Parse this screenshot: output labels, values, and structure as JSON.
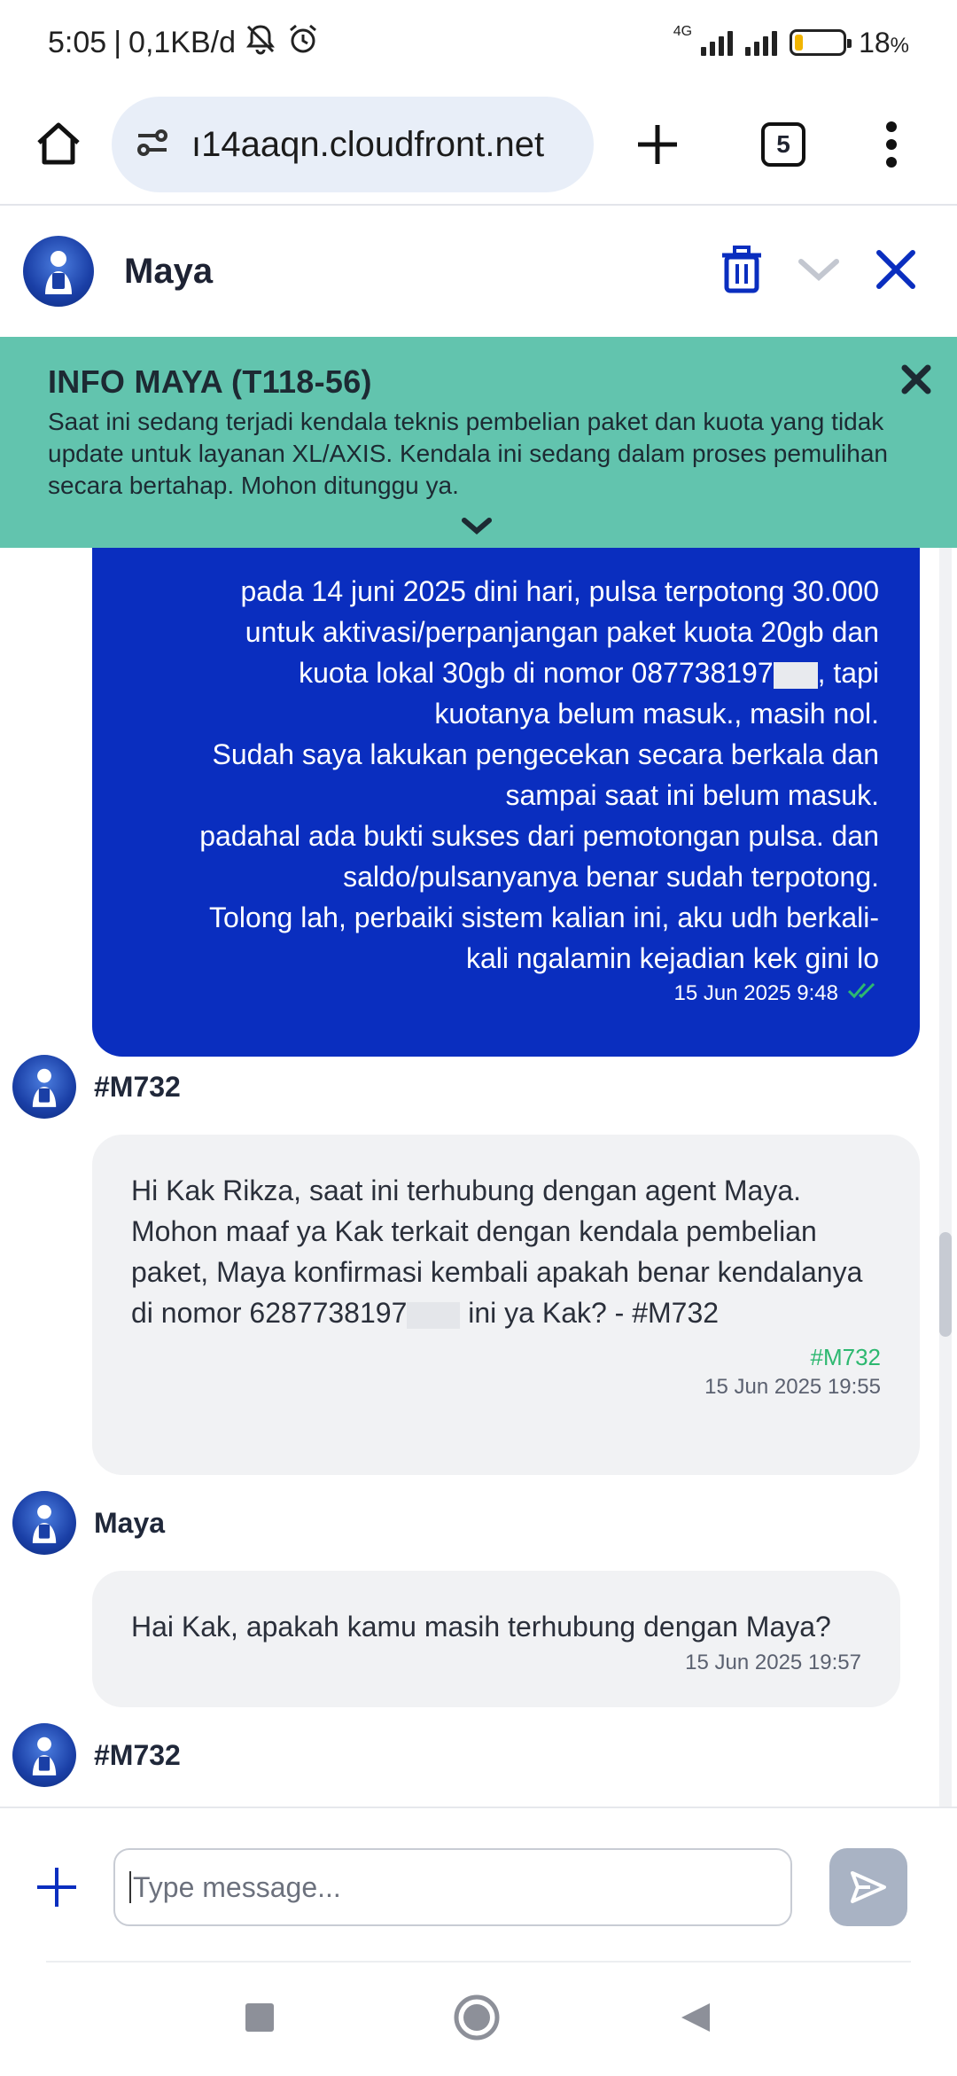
{
  "status_bar": {
    "time": "5:05",
    "separator": "|",
    "data_rate": "0,1KB/d",
    "network_tag": "4G",
    "battery_percent": 18,
    "battery_text": "18",
    "battery_unit": "%"
  },
  "browser": {
    "url": "ı14aaqn.cloudfront.net",
    "tab_count": "5"
  },
  "chat_header": {
    "name": "Maya"
  },
  "info_banner": {
    "title": "INFO MAYA (T118-56)",
    "text": "Saat ini sedang terjadi kendala teknis pembelian paket dan kuota yang tidak update untuk layanan XL/AXIS. Kendala ini sedang dalam proses pemulihan secara bertahap. Mohon ditunggu ya."
  },
  "messages": {
    "outgoing": {
      "line1": "pada 14 juni 2025 dini hari, pulsa terpotong 30.000",
      "line2": "untuk aktivasi/perpanjangan paket kuota 20gb dan",
      "line3_a": "kuota lokal 30gb di nomor 08773819",
      "line3_b": ", tapi",
      "line4": "kuotanya belum masuk., masih nol.",
      "line5": "Sudah saya lakukan pengecekan secara berkala dan",
      "line6": "sampai saat ini belum masuk.",
      "line7": "padahal ada bukti sukses dari pemotongan pulsa. dan",
      "line8": "saldo/pulsanyanya benar sudah terpotong.",
      "line9": "Tolong lah, perbaiki sistem kalian ini, aku udh berkali-",
      "line10": "kali ngalamin kejadian kek gini lo",
      "time": "15 Jun 2025 9:48"
    },
    "msg1": {
      "sender": "#M732",
      "text_a": "Hi Kak Rikza, saat ini terhubung dengan agent Maya. Mohon maaf ya Kak terkait dengan kendala pembelian paket, Maya konfirmasi kembali apakah benar kendalanya di nomor 6287738197",
      "text_b": " ini ya Kak? - #M732",
      "tag": "#M732",
      "time": "15 Jun 2025 19:55"
    },
    "msg2": {
      "sender": "Maya",
      "text": "Hai Kak, apakah kamu masih terhubung dengan Maya?",
      "time": "15 Jun 2025 19:57"
    },
    "msg3": {
      "sender": "#M732"
    }
  },
  "composer": {
    "placeholder": "Type message..."
  },
  "colors": {
    "brand_blue": "#0a2ebf",
    "banner_teal": "#62c4ae",
    "agent_tag_green": "#2db870",
    "bubble_gray": "#f1f2f4"
  }
}
